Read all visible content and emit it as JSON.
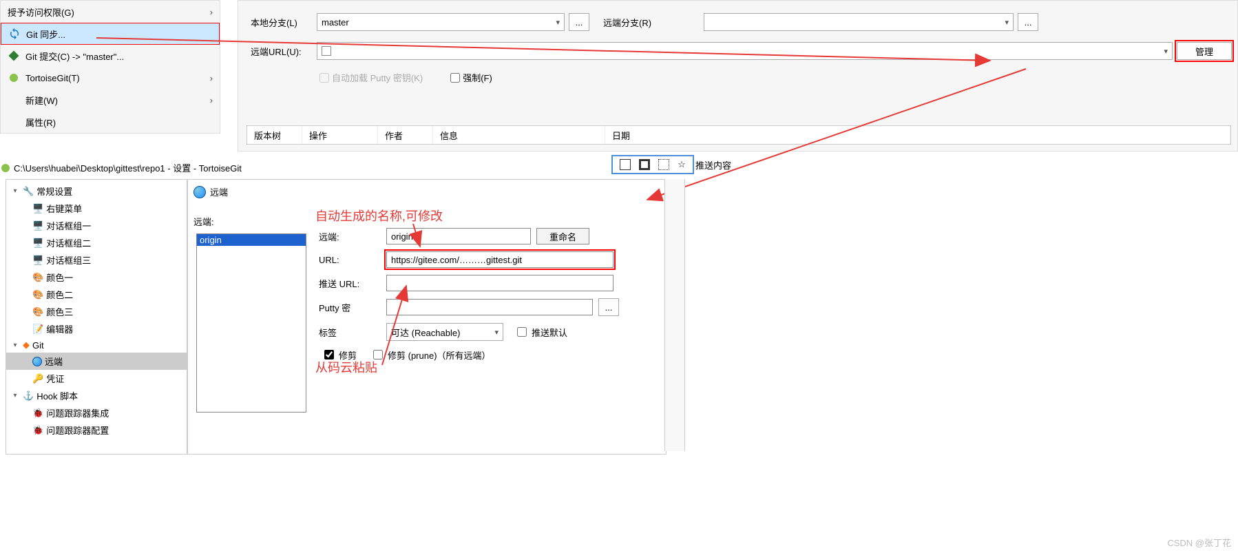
{
  "context_menu": {
    "grant": "授予访问权限(G)",
    "git_sync": "Git 同步...",
    "git_commit": "Git 提交(C) -> \"master\"...",
    "tortoise": "TortoiseGit(T)",
    "new": "新建(W)",
    "properties": "属性(R)"
  },
  "sync": {
    "local_branch_label": "本地分支(L)",
    "local_branch_value": "master",
    "remote_branch_label": "远端分支(R)",
    "remote_branch_value": "",
    "remote_url_label": "远端URL(U):",
    "remote_url_value": "",
    "manage": "管理",
    "auto_load_putty": "自动加载 Putty 密钥(K)",
    "force": "强制(F)",
    "dots": "..."
  },
  "columns": {
    "tree": "版本树",
    "op": "操作",
    "author": "作者",
    "info": "信息",
    "date": "日期"
  },
  "push_content": "推送内容",
  "settings_title": "C:\\Users\\huabei\\Desktop\\gittest\\repo1 - 设置 - TortoiseGit",
  "tree": {
    "general": "常规设置",
    "context_menu": "右键菜单",
    "dlg1": "对话框组一",
    "dlg2": "对话框组二",
    "dlg3": "对话框组三",
    "color1": "颜色一",
    "color2": "颜色二",
    "color3": "颜色三",
    "editor": "编辑器",
    "git": "Git",
    "remote": "远端",
    "cred": "凭证",
    "hook": "Hook 脚本",
    "issue_int": "问题跟踪器集成",
    "issue_cfg": "问题跟踪器配置"
  },
  "remote_panel": {
    "title": "远端",
    "list_label": "远端:",
    "origin": "origin",
    "remote_label": "远端:",
    "remote_value": "origin",
    "rename": "重命名",
    "url_label": "URL:",
    "url_value": "https://gitee.com/………gittest.git",
    "push_url_label": "推送 URL:",
    "push_url_value": "",
    "putty_label": "Putty 密",
    "putty_value": "",
    "dots": "...",
    "tag_label": "标签",
    "tag_value": "可达 (Reachable)",
    "push_default": "推送默认",
    "prune1": "修剪",
    "prune2": "修剪 (prune)（所有远端）"
  },
  "annotations": {
    "auto_name": "自动生成的名称,可修改",
    "paste": "从码云粘贴"
  },
  "watermark": "CSDN @张丁花"
}
